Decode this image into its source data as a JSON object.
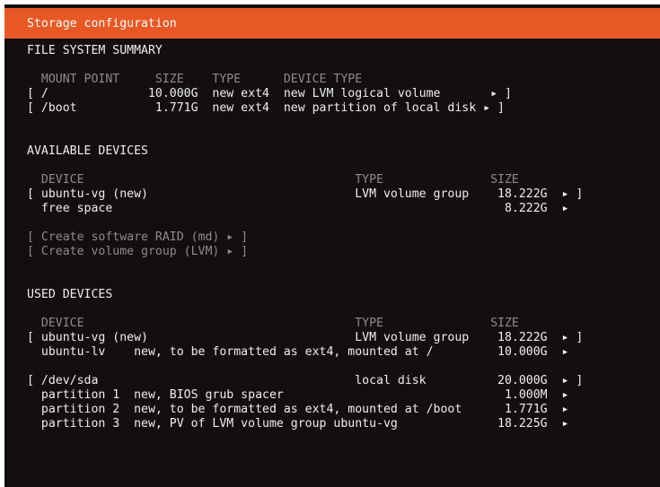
{
  "title": "Storage configuration",
  "fs_summary": {
    "heading": "FILE SYSTEM SUMMARY",
    "header_row": "  MOUNT POINT     SIZE    TYPE      DEVICE TYPE",
    "rows": [
      "[ /              10.000G  new ext4  new LVM logical volume       ▸ ]",
      "[ /boot           1.771G  new ext4  new partition of local disk ▸ ]"
    ]
  },
  "available": {
    "heading": "AVAILABLE DEVICES",
    "header_row": "  DEVICE                                      TYPE               SIZE",
    "rows": [
      "[ ubuntu-vg (new)                             LVM volume group    18.222G  ▸ ]",
      "  free space                                                       8.222G  ▸"
    ],
    "actions": [
      "[ Create software RAID (md) ▸ ]",
      "[ Create volume group (LVM) ▸ ]"
    ]
  },
  "used": {
    "heading": "USED DEVICES",
    "header_row": "  DEVICE                                      TYPE               SIZE",
    "rows": [
      "[ ubuntu-vg (new)                             LVM volume group    18.222G  ▸ ]",
      "  ubuntu-lv    new, to be formatted as ext4, mounted at /         10.000G  ▸",
      "[ /dev/sda                                    local disk          20.000G  ▸ ]",
      "  partition 1  new, BIOS grub spacer                               1.000M  ▸",
      "  partition 2  new, to be formatted as ext4, mounted at /boot      1.771G  ▸",
      "  partition 3  new, PV of LVM volume group ubuntu-vg              18.225G  ▸"
    ]
  },
  "colors": {
    "title_bar": "#e85825",
    "background": "#130e12",
    "text": "#eeeeee",
    "dim_text": "#8c8c8c"
  }
}
